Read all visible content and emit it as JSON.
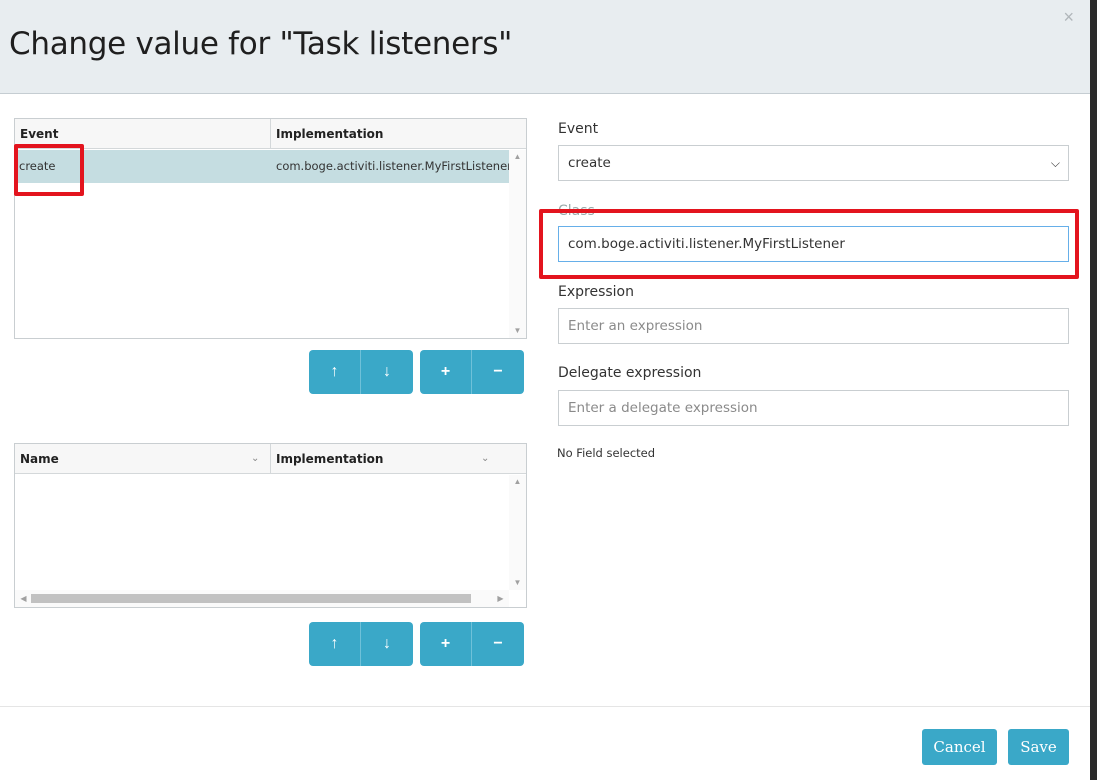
{
  "dialog": {
    "title": "Change value for \"Task listeners\"",
    "close_glyph": "×"
  },
  "listeners_grid": {
    "columns": [
      "Event",
      "Implementation"
    ],
    "rows": [
      {
        "event": "create",
        "implementation": "com.boge.activiti.listener.MyFirstListener",
        "selected": true
      }
    ]
  },
  "fields_grid": {
    "columns": [
      "Name",
      "Implementation"
    ],
    "rows": []
  },
  "buttons": {
    "move_up": "↑",
    "move_down": "↓",
    "add": "+",
    "remove": "−"
  },
  "form": {
    "event_label": "Event",
    "event_value": "create",
    "class_label": "Class",
    "class_value": "com.boge.activiti.listener.MyFirstListener",
    "expression_label": "Expression",
    "expression_placeholder": "Enter an expression",
    "delegate_label": "Delegate expression",
    "delegate_placeholder": "Enter a delegate expression",
    "no_field_text": "No Field selected"
  },
  "footer": {
    "cancel_label": "Cancel",
    "save_label": "Save"
  },
  "colors": {
    "accent": "#3aa8c8",
    "selected_row": "#c5dde1",
    "highlight": "#e3141e",
    "header_bg": "#e8edf0"
  }
}
